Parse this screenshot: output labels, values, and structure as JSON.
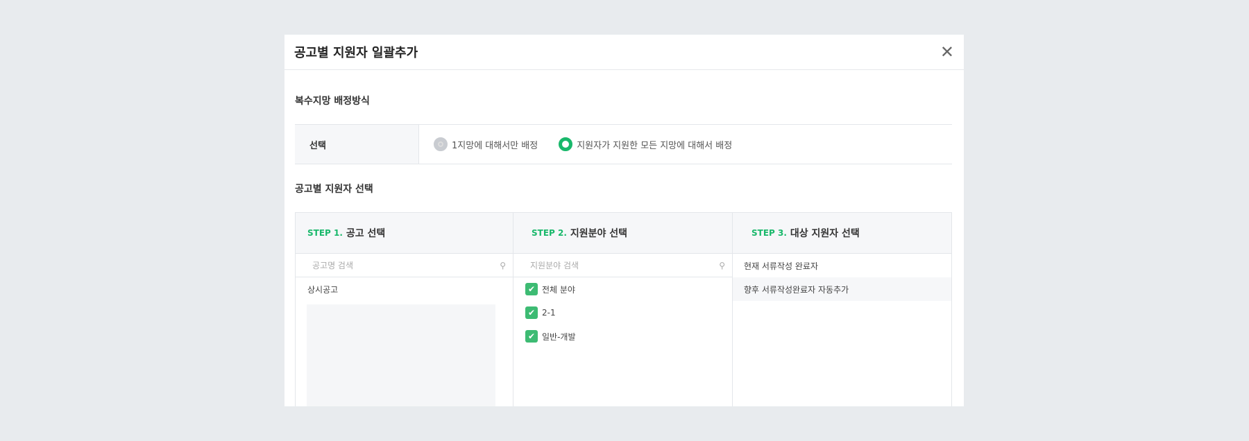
{
  "modal": {
    "title": "공고별 지원자 일괄추가",
    "close_icon": "close-icon"
  },
  "assign": {
    "section_title": "복수지망 배정방식",
    "label": "선택",
    "options": [
      {
        "label": "1지망에 대해서만 배정",
        "selected": false
      },
      {
        "label": "지원자가 지원한 모든 지망에 대해서 배정",
        "selected": true
      }
    ]
  },
  "select": {
    "section_title": "공고별 지원자 선택",
    "steps": [
      {
        "step": "STEP 1.",
        "title": "공고 선택",
        "placeholder": "공고명 검색",
        "items": [
          "상시공고"
        ]
      },
      {
        "step": "STEP 2.",
        "title": "지원분야 선택",
        "placeholder": "지원분야 검색",
        "items": [
          "전체 분야",
          "2-1",
          "일반-개발"
        ]
      },
      {
        "step": "STEP 3.",
        "title": "대상 지원자 선택",
        "items": [
          "현재 서류작성 완료자",
          "향후 서류작성완료자 자동추가"
        ]
      }
    ]
  },
  "colors": {
    "accent": "#19b86b"
  }
}
